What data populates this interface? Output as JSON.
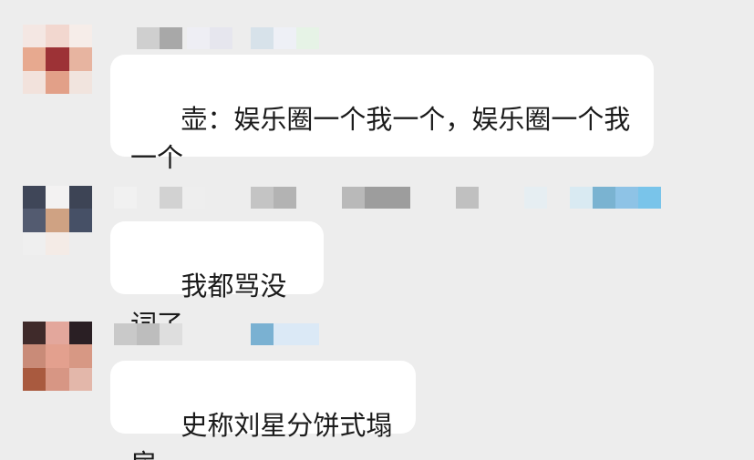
{
  "messages": [
    {
      "text": "壶：娱乐圈一个我一个，娱乐圈一个我一个",
      "avatar_colors": [
        "#f4e7e3",
        "#f2d7cf",
        "#f6ede9",
        "#e7a98f",
        "#9d3236",
        "#e7b4a0",
        "#f2e2dc",
        "#e2a088",
        "#f1e4de"
      ],
      "name_colors": [
        "#cfcfcf",
        "#a8a8a8",
        "#eeeef4",
        "#e6e6ee",
        "#d7e2ea",
        "#eef0f6",
        "#e6f3e6"
      ]
    },
    {
      "text": "我都骂没词了",
      "avatar_colors": [
        "#3f4658",
        "#f3f2f2",
        "#3d4455",
        "#535b70",
        "#cfa283",
        "#465066",
        "#efefef",
        "#f4ebe6",
        "#ededed"
      ],
      "name_colors": [
        "#f1f1f1",
        "#d2d2d2",
        "#eeeeee",
        "#c4c4c4",
        "#b3b3b3",
        "#b9b9b9",
        "#9d9d9d",
        "#c0c0c0",
        "#e6eef2",
        "#d9eaf2",
        "#7ab3d1",
        "#8ec3e6",
        "#79c4ea"
      ]
    },
    {
      "text": "史称刘星分饼式塌房",
      "avatar_colors": [
        "#3f2a2a",
        "#e3a79c",
        "#2a1f24",
        "#c98b78",
        "#e3a08e",
        "#d79884",
        "#a95a3f",
        "#d79684",
        "#e3b7aa"
      ],
      "name_colors": [
        "#c9c9c9",
        "#bdbdbd",
        "#dedede",
        "#7ab1d2",
        "#dbe9f6"
      ]
    }
  ]
}
